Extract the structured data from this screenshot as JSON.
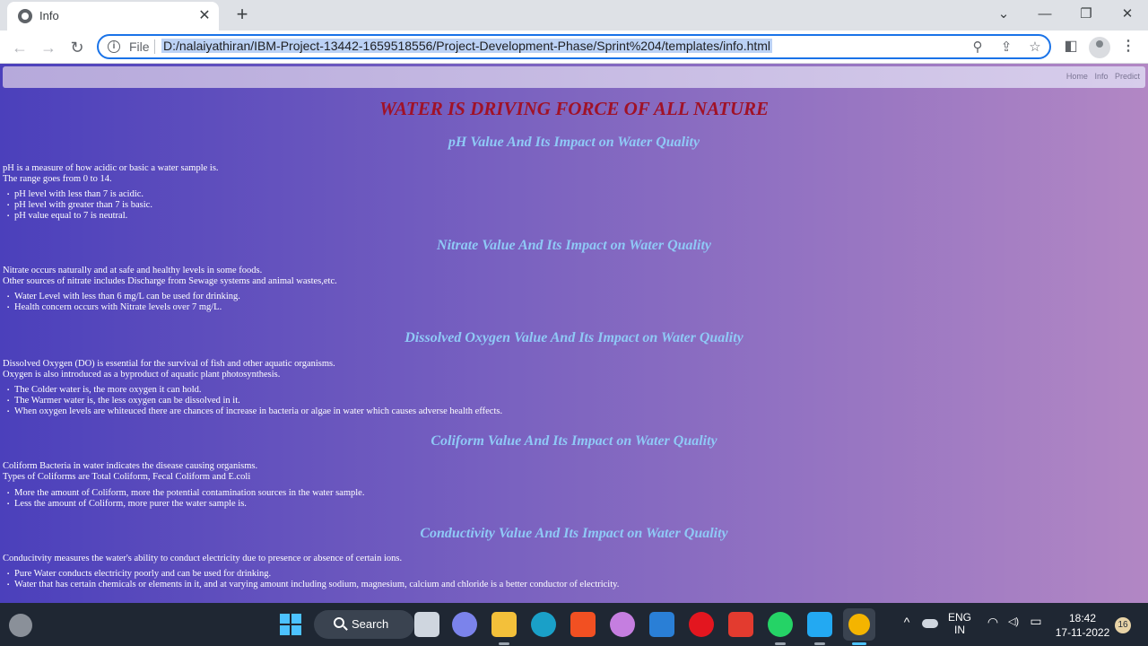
{
  "browser": {
    "tab_title": "Info",
    "tab_close": "✕",
    "new_tab": "+",
    "window_controls": {
      "dropdown": "⌄",
      "minimize": "—",
      "restore": "❐",
      "close": "✕"
    },
    "nav": {
      "back": "←",
      "forward": "→",
      "reload": "↻"
    },
    "omnibox": {
      "info_glyph": "i",
      "scheme_label": "File",
      "url": "D:/nalaiyathiran/IBM-Project-13442-1659518556/Project-Development-Phase/Sprint%204/templates/info.html",
      "zoom_icon": "⚲",
      "share_icon": "⇪",
      "bookmark_icon": "☆"
    },
    "sidepanel_icon": "◧",
    "menu_icon": "⋮"
  },
  "site_nav": {
    "items": [
      "Home",
      "Info",
      "Predict"
    ]
  },
  "page": {
    "title": "WATER IS DRIVING FORCE OF ALL NATURE",
    "sections": [
      {
        "heading": "pH Value And Its Impact on Water Quality",
        "paragraph": [
          "pH is a measure of how acidic or basic a water sample is.",
          "The range goes from 0 to 14."
        ],
        "bullets": [
          "pH level with less than 7 is acidic.",
          "pH level with greater than 7 is basic.",
          "pH value equal to 7 is neutral."
        ]
      },
      {
        "heading": "Nitrate Value And Its Impact on Water Quality",
        "paragraph": [
          "Nitrate occurs naturally and at safe and healthy levels in some foods.",
          "Other sources of nitrate includes Discharge from Sewage systems and animal wastes,etc."
        ],
        "bullets": [
          "Water Level with less than 6 mg/L can be used for drinking.",
          "Health concern occurs with Nitrate levels over 7 mg/L."
        ]
      },
      {
        "heading": "Dissolved Oxygen Value And Its Impact on Water Quality",
        "paragraph": [
          "Dissolved Oxygen (DO) is essential for the survival of fish and other aquatic organisms.",
          "Oxygen is also introduced as a byproduct of aquatic plant photosynthesis."
        ],
        "bullets": [
          "The Colder water is, the more oxygen it can hold.",
          "The Warmer water is, the less oxygen can be dissolved in it.",
          "When oxygen levels are whiteuced there are chances of increase in bacteria or algae in water which causes adverse health effects."
        ]
      },
      {
        "heading": "Coliform Value And Its Impact on Water Quality",
        "paragraph": [
          "Coliform Bacteria in water indicates the disease causing organisms.",
          "Types of Coliforms are Total Coliform, Fecal Coliform and E.coli"
        ],
        "bullets": [
          "More the amount of Coliform, more the potential contamination sources in the water sample.",
          "Less the amount of Coliform, more purer the water sample is."
        ]
      },
      {
        "heading": "Conductivity Value And Its Impact on Water Quality",
        "paragraph": [
          "Conducitvity measures the water's ability to conduct electricity due to presence or absence of certain ions."
        ],
        "bullets": [
          "Pure Water conducts electricity poorly and can be used for drinking.",
          "Water that has certain chemicals or elements in it, and at varying amount including sodium, magnesium, calcium and chloride is a better conductor of electricity."
        ]
      }
    ]
  },
  "taskbar": {
    "search_label": "Search",
    "lang_primary": "ENG",
    "lang_secondary": "IN",
    "time": "18:42",
    "date": "17-11-2022",
    "notification_count": "16",
    "tray_chevron": "^",
    "wifi_icon": "◠",
    "volume_icon": "◁)",
    "battery_icon": "▭",
    "app_colors": {
      "windows": "#4cc2ff",
      "files": "#cfd6df",
      "meet": "#7b83eb",
      "explorer": "#f3c03a",
      "edge": "#1aa0c8",
      "store": "#f25022",
      "media": "#c57ee0",
      "app_blue": "#2a7fd6",
      "opera": "#e3161f",
      "wps": "#e33b2f",
      "whatsapp": "#25d366",
      "vscode": "#23a9f2",
      "chrome": "#f4b400"
    }
  }
}
